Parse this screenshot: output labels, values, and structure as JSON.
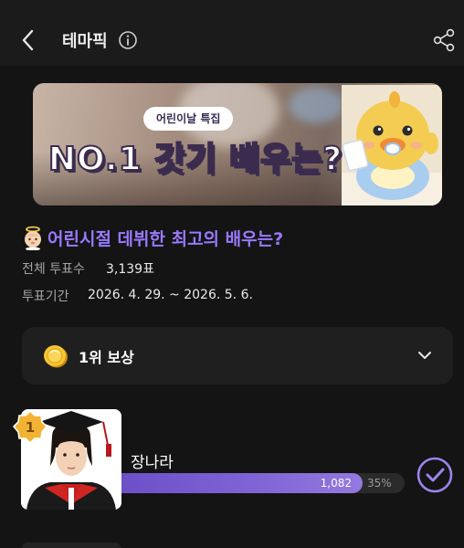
{
  "header": {
    "title": "테마픽",
    "back_icon": "chevron-left-icon",
    "info_icon": "info-circle-icon",
    "share_icon": "share-icon"
  },
  "banner": {
    "chip": "어린이날 특집",
    "headline": "NO.1 갓기 배우는?"
  },
  "poll": {
    "question": "어린시절 데뷔한 최고의 배우는?",
    "total_votes_label": "전체 투표수",
    "total_votes_value": "3,139표",
    "period_label": "투표기간",
    "period_value": "2026. 4. 29. ~ 2026. 5. 6."
  },
  "reward": {
    "label": "1위 보상",
    "icon": "coin-icon",
    "toggle_icon": "chevron-down-icon"
  },
  "candidates": [
    {
      "rank": "1",
      "name": "장나라",
      "votes": "1,082",
      "percent": "35%",
      "share": 0.35,
      "voted": true
    }
  ],
  "colors": {
    "background": "#141414",
    "accent_purple": "#9a79ff",
    "bar_purple": "#7e61d6",
    "medal_gold": "#f2b233"
  }
}
